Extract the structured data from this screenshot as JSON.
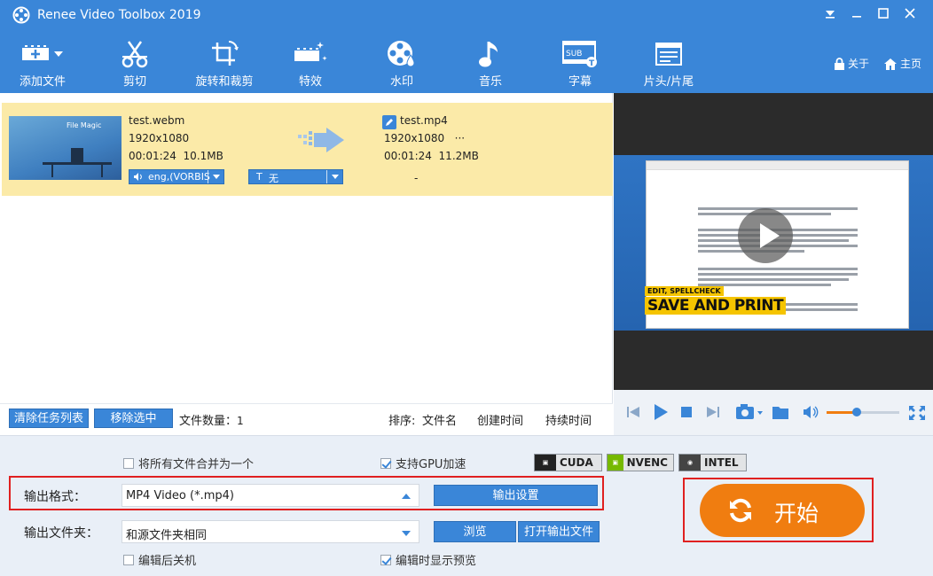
{
  "app": {
    "title": "Renee Video Toolbox 2019"
  },
  "toolbar": {
    "items": [
      {
        "label": "添加文件",
        "icon": "add-file-icon"
      },
      {
        "label": "剪切",
        "icon": "scissors-icon"
      },
      {
        "label": "旋转和裁剪",
        "icon": "rotate-crop-icon"
      },
      {
        "label": "特效",
        "icon": "effects-icon"
      },
      {
        "label": "水印",
        "icon": "watermark-icon"
      },
      {
        "label": "音乐",
        "icon": "music-icon"
      },
      {
        "label": "字幕",
        "icon": "subtitle-icon"
      },
      {
        "label": "片头/片尾",
        "icon": "intro-outro-icon"
      }
    ],
    "about": "关于",
    "home": "主页"
  },
  "task": {
    "thumbnail_text": "File Magic",
    "source": {
      "name": "test.webm",
      "resolution": "1920x1080",
      "duration": "00:01:24",
      "size": "10.1MB"
    },
    "output": {
      "name": "test.mp4",
      "resolution": "1920x1080",
      "more": "···",
      "duration": "00:01:24",
      "size": "11.2MB"
    },
    "audio_track": "eng,(VORBIS",
    "subtitle": "无",
    "subtitle_prefix": "T",
    "output_dash": "-"
  },
  "taskbar": {
    "clear_label": "清除任务列表",
    "remove_label": "移除选中",
    "file_count_label": "文件数量：",
    "file_count": "1",
    "sort_label": "排序:",
    "sort_name": "文件名",
    "sort_created": "创建时间",
    "sort_duration": "持续时间"
  },
  "preview": {
    "badge_small": "EDIT, SPELLCHECK",
    "badge_big": "SAVE AND PRINT",
    "volume_level": 0.42
  },
  "settings": {
    "merge_label": "将所有文件合并为一个",
    "merge_checked": false,
    "gpu_label": "支持GPU加速",
    "gpu_checked": true,
    "tech": [
      "CUDA",
      "NVENC",
      "INTEL"
    ],
    "format_label": "输出格式：",
    "format_value": "MP4 Video (*.mp4)",
    "output_settings_label": "输出设置",
    "folder_label": "输出文件夹：",
    "folder_value": "和源文件夹相同",
    "browse_label": "浏览",
    "open_folder_label": "打开输出文件",
    "shutdown_label": "编辑后关机",
    "shutdown_checked": false,
    "preview_on_edit_label": "编辑时显示预览",
    "preview_on_edit_checked": true,
    "start_label": "开始"
  },
  "colors": {
    "accent": "#3a86d8",
    "highlight_row": "#fbeaa8",
    "start": "#f07d10",
    "callout": "#e02020"
  }
}
